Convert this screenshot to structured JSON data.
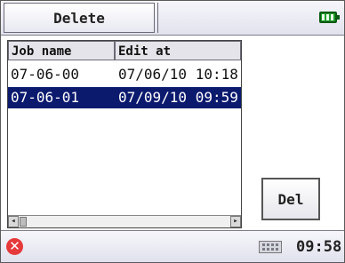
{
  "header": {
    "title": "Delete",
    "battery_icon": "battery-full-icon",
    "battery_color": "#1f9a2a"
  },
  "table": {
    "columns": [
      "Job name",
      "Edit at"
    ],
    "rows": [
      {
        "job_name": "07-06-00",
        "edit_at": "07/06/10 10:18",
        "selected": false
      },
      {
        "job_name": "07-06-01",
        "edit_at": "07/09/10 09:59",
        "selected": true
      }
    ],
    "selection_color": "#0c1a6e"
  },
  "actions": {
    "del_label": "Del"
  },
  "footer": {
    "close_icon": "close-icon",
    "close_glyph": "✕",
    "keyboard_icon": "keyboard-icon",
    "time": "09:58"
  }
}
